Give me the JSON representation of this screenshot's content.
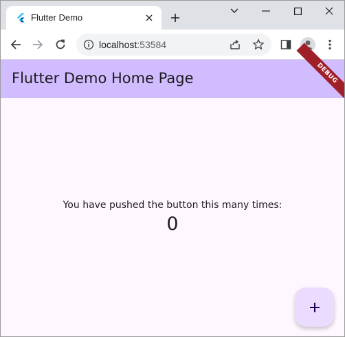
{
  "browser": {
    "tab_title": "Flutter Demo",
    "url_host": "localhost",
    "url_port": ":53584"
  },
  "app": {
    "title": "Flutter Demo Home Page",
    "debug_banner": "DEBUG",
    "message": "You have pushed the button this many times:",
    "counter": "0",
    "fab_icon": "plus-icon"
  },
  "colors": {
    "appbar": "#d0bcff",
    "background": "#fef7ff",
    "fab": "#ebdcff",
    "debug": "#a0202a"
  }
}
